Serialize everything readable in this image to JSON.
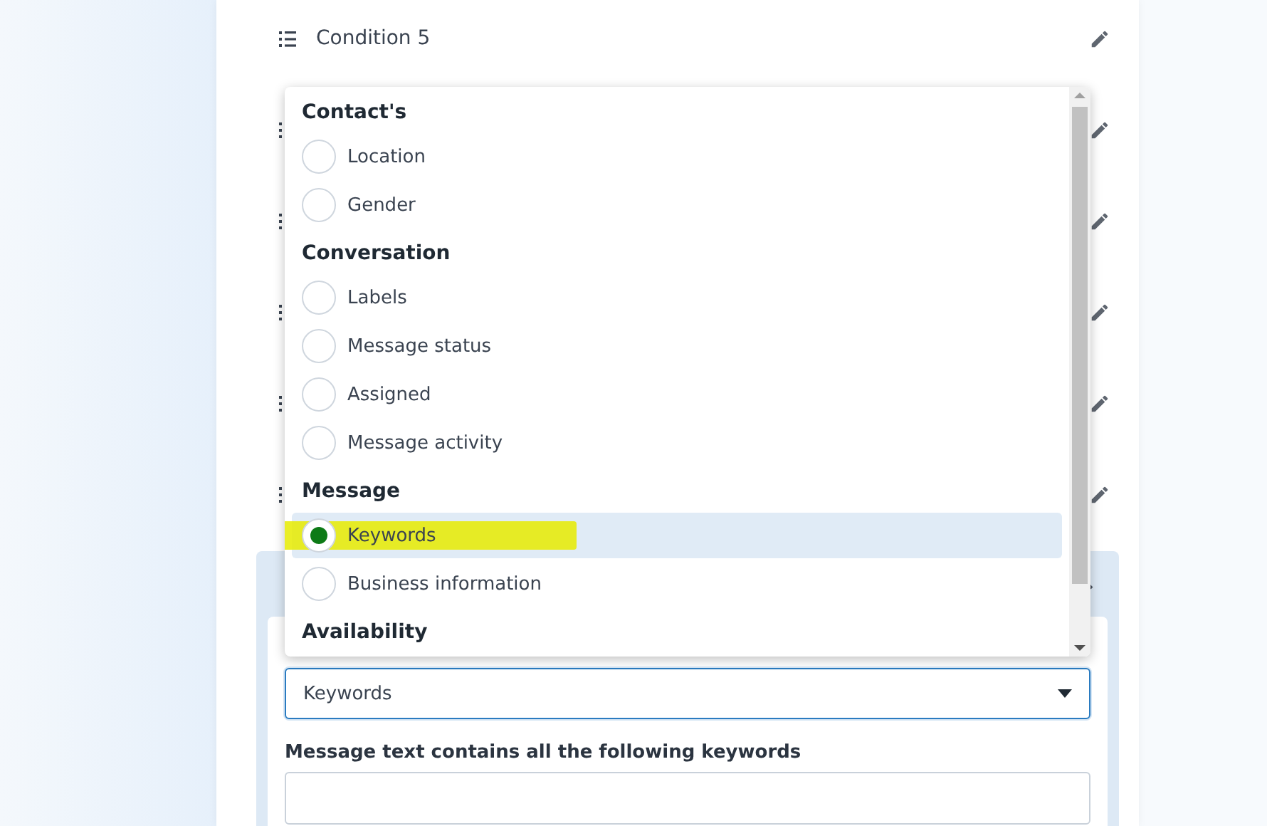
{
  "conditions": [
    {
      "title": "Condition 5",
      "expanded": false
    },
    {
      "expanded": false
    },
    {
      "expanded": false
    },
    {
      "expanded": false
    },
    {
      "expanded": false
    },
    {
      "expanded": false
    },
    {
      "expanded": true,
      "select": {
        "value": "Keywords"
      },
      "field": {
        "label": "Message text contains all the following keywords"
      }
    }
  ],
  "dropdown": {
    "groups": [
      {
        "label": "Contact's",
        "items": [
          {
            "label": "Location",
            "selected": false
          },
          {
            "label": "Gender",
            "selected": false
          }
        ]
      },
      {
        "label": "Conversation",
        "items": [
          {
            "label": "Labels",
            "selected": false
          },
          {
            "label": "Message status",
            "selected": false
          },
          {
            "label": "Assigned",
            "selected": false
          },
          {
            "label": "Message activity",
            "selected": false
          }
        ]
      },
      {
        "label": "Message",
        "items": [
          {
            "label": "Keywords",
            "selected": true,
            "highlighted": true
          },
          {
            "label": "Business information",
            "selected": false
          }
        ]
      },
      {
        "label": "Availability"
      }
    ]
  }
}
